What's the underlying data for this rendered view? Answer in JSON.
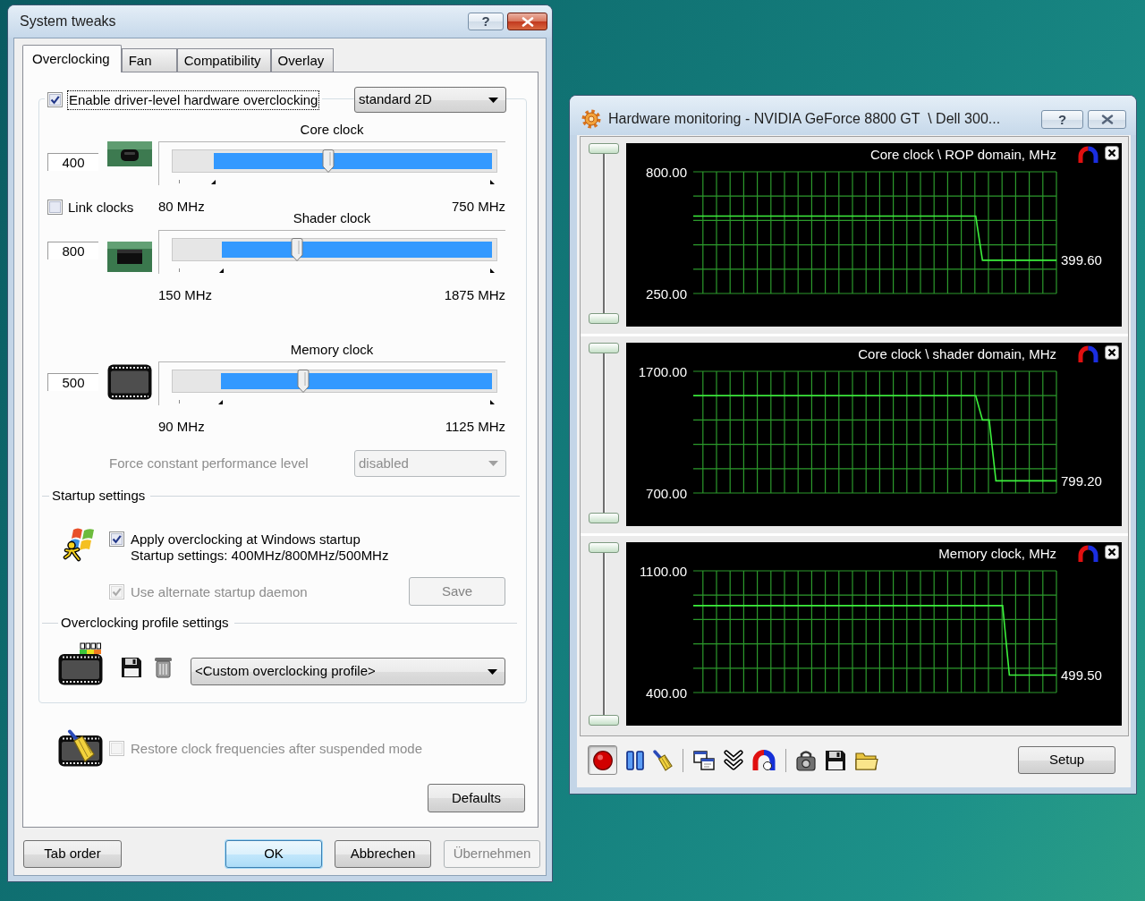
{
  "dialog": {
    "title": "System tweaks",
    "help_button": "?",
    "tabs": [
      {
        "label": "Overclocking",
        "selected": true
      },
      {
        "label": "Fan",
        "selected": false
      },
      {
        "label": "Compatibility",
        "selected": false
      },
      {
        "label": "Overlay",
        "selected": false
      }
    ],
    "enable_overclocking": {
      "label": "Enable driver-level hardware overclocking",
      "checked": true,
      "focused": true
    },
    "performance_mode": {
      "value": "standard 2D"
    },
    "clocks": [
      {
        "kind": "core",
        "title": "Core clock",
        "value": "400",
        "level": 0.478,
        "selection": {
          "level": 0.854
        },
        "min_label": "80 MHz",
        "max_label": "750 MHz"
      },
      {
        "kind": "shader",
        "title": "Shader clock",
        "value": "800",
        "level": 0.377,
        "selection": {
          "level": 0.83
        },
        "min_label": "150 MHz",
        "max_label": "1875 MHz"
      },
      {
        "kind": "memory",
        "title": "Memory clock",
        "value": "500",
        "level": 0.396,
        "selection": {
          "level": 0.832
        },
        "min_label": "90 MHz",
        "max_label": "1125 MHz"
      }
    ],
    "link_clocks": {
      "label": "Link clocks",
      "checked": false
    },
    "force_performance_level": {
      "label": "Force constant performance level",
      "value": "disabled",
      "disabled": true
    },
    "startup_settings": {
      "title": "Startup settings",
      "apply_at_startup": {
        "label": "Apply overclocking at Windows startup",
        "checked": true
      },
      "summary": "Startup settings: 400MHz/800MHz/500MHz",
      "alternate_daemon": {
        "label": "Use alternate startup daemon",
        "checked": true,
        "disabled": true
      },
      "save_button": {
        "label": "Save",
        "disabled": true
      }
    },
    "profile_settings": {
      "title": "Overclocking profile settings",
      "profile": {
        "value": "<Custom overclocking profile>"
      }
    },
    "restore_after_suspend": {
      "label": "Restore clock frequencies after suspended mode",
      "checked": false,
      "disabled": true
    },
    "defaults_button": {
      "label": "Defaults"
    },
    "tab_order_button": {
      "label": "Tab order"
    },
    "buttons": [
      {
        "label": "OK",
        "default": true,
        "disabled": false
      },
      {
        "label": "Abbrechen",
        "default": false,
        "disabled": false
      },
      {
        "label": "Übernehmen",
        "default": false,
        "disabled": true
      }
    ]
  },
  "monitor": {
    "title": "Hardware monitoring - NVIDIA GeForce 8800 GT  \\ Dell 300...",
    "help_button": "?",
    "graphs": [
      {
        "reading": "399.60",
        "chart_data": {
          "type": "line",
          "title": "Core clock \\ ROP domain, MHz",
          "ylim": [
            250,
            800
          ],
          "yticks": [
            {
              "value": 250,
              "label": "250.00"
            },
            {
              "value": 800,
              "label": "800.00"
            }
          ],
          "grid": true,
          "series": [
            {
              "color": "#3cf03c",
              "values": [
                600,
                600,
                600,
                600,
                600,
                600,
                600,
                600,
                600,
                600,
                600,
                600,
                600,
                600,
                600,
                600,
                600,
                600,
                600,
                600,
                600,
                600,
                600,
                600,
                600,
                600,
                600,
                600,
                600,
                600,
                600,
                600,
                600,
                600,
                600,
                600,
                600,
                600,
                600,
                600,
                600,
                600,
                600,
                400,
                400,
                400,
                400,
                400,
                400,
                400,
                400,
                400,
                400,
                400,
                400
              ]
            }
          ]
        }
      },
      {
        "reading": "799.20",
        "chart_data": {
          "type": "line",
          "title": "Core clock \\ shader domain, MHz",
          "ylim": [
            700,
            1700
          ],
          "yticks": [
            {
              "value": 700,
              "label": "700.00"
            },
            {
              "value": 1700,
              "label": "1700.00"
            }
          ],
          "grid": true,
          "series": [
            {
              "color": "#3cf03c",
              "values": [
                1500,
                1500,
                1500,
                1500,
                1500,
                1500,
                1500,
                1500,
                1500,
                1500,
                1500,
                1500,
                1500,
                1500,
                1500,
                1500,
                1500,
                1500,
                1500,
                1500,
                1500,
                1500,
                1500,
                1500,
                1500,
                1500,
                1500,
                1500,
                1500,
                1500,
                1500,
                1500,
                1500,
                1500,
                1500,
                1500,
                1500,
                1500,
                1500,
                1500,
                1500,
                1500,
                1500,
                1300,
                1300,
                800,
                800,
                800,
                800,
                800,
                800,
                800,
                800,
                800,
                800
              ]
            }
          ]
        }
      },
      {
        "reading": "499.50",
        "chart_data": {
          "type": "line",
          "title": "Memory clock, MHz",
          "ylim": [
            400,
            1100
          ],
          "yticks": [
            {
              "value": 400,
              "label": "400.00"
            },
            {
              "value": 1100,
              "label": "1100.00"
            }
          ],
          "grid": true,
          "series": [
            {
              "color": "#3cf03c",
              "values": [
                900,
                900,
                900,
                900,
                900,
                900,
                900,
                900,
                900,
                900,
                900,
                900,
                900,
                900,
                900,
                900,
                900,
                900,
                900,
                900,
                900,
                900,
                900,
                900,
                900,
                900,
                900,
                900,
                900,
                900,
                900,
                900,
                900,
                900,
                900,
                900,
                900,
                900,
                900,
                900,
                900,
                900,
                900,
                900,
                900,
                900,
                900,
                500,
                500,
                500,
                500,
                500,
                500,
                500,
                500
              ]
            }
          ]
        }
      }
    ],
    "toolbar": [
      [
        {
          "kind": "record",
          "pressed": true
        },
        {
          "kind": "pause",
          "pressed": false
        },
        {
          "kind": "clear",
          "pressed": false
        }
      ],
      [
        {
          "kind": "windows",
          "pressed": false
        },
        {
          "kind": "collapse",
          "pressed": false
        },
        {
          "kind": "magnet",
          "pressed": false
        }
      ],
      [
        {
          "kind": "lock",
          "pressed": false
        },
        {
          "kind": "save",
          "pressed": false
        },
        {
          "kind": "open",
          "pressed": false
        }
      ]
    ],
    "setup_button": {
      "label": "Setup"
    }
  }
}
